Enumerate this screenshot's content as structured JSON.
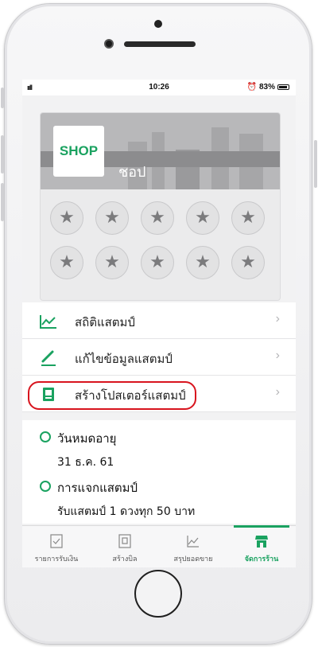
{
  "status": {
    "signal": "ııll",
    "time": "10:26",
    "battery": "83%"
  },
  "shop": {
    "logo_text": "SHOP",
    "name": "ชอป",
    "star_count": 10
  },
  "menu": {
    "items": [
      {
        "label": "สถิติแสตมป์",
        "icon": "chart-icon"
      },
      {
        "label": "แก้ไขข้อมูลแสตมป์",
        "icon": "pencil-icon"
      },
      {
        "label": "สร้างโปสเตอร์แสตมป์",
        "icon": "poster-icon"
      }
    ]
  },
  "info": {
    "expiry_title": "วันหมดอายุ",
    "expiry_value": "31 ธ.ค. 61",
    "rule_title": "การแจกแสตมป์",
    "rule_value": "รับแสตมป์ 1 ดวงทุก 50 บาท"
  },
  "tabs": [
    {
      "label": "รายการรับเงิน",
      "icon": "receipt-icon",
      "active": false
    },
    {
      "label": "สร้างบิล",
      "icon": "bill-icon",
      "active": false
    },
    {
      "label": "สรุปยอดขาย",
      "icon": "line-chart-icon",
      "active": false
    },
    {
      "label": "จัดการร้าน",
      "icon": "store-icon",
      "active": true
    }
  ],
  "colors": {
    "accent": "#1aa260",
    "highlight": "#d8141e"
  }
}
